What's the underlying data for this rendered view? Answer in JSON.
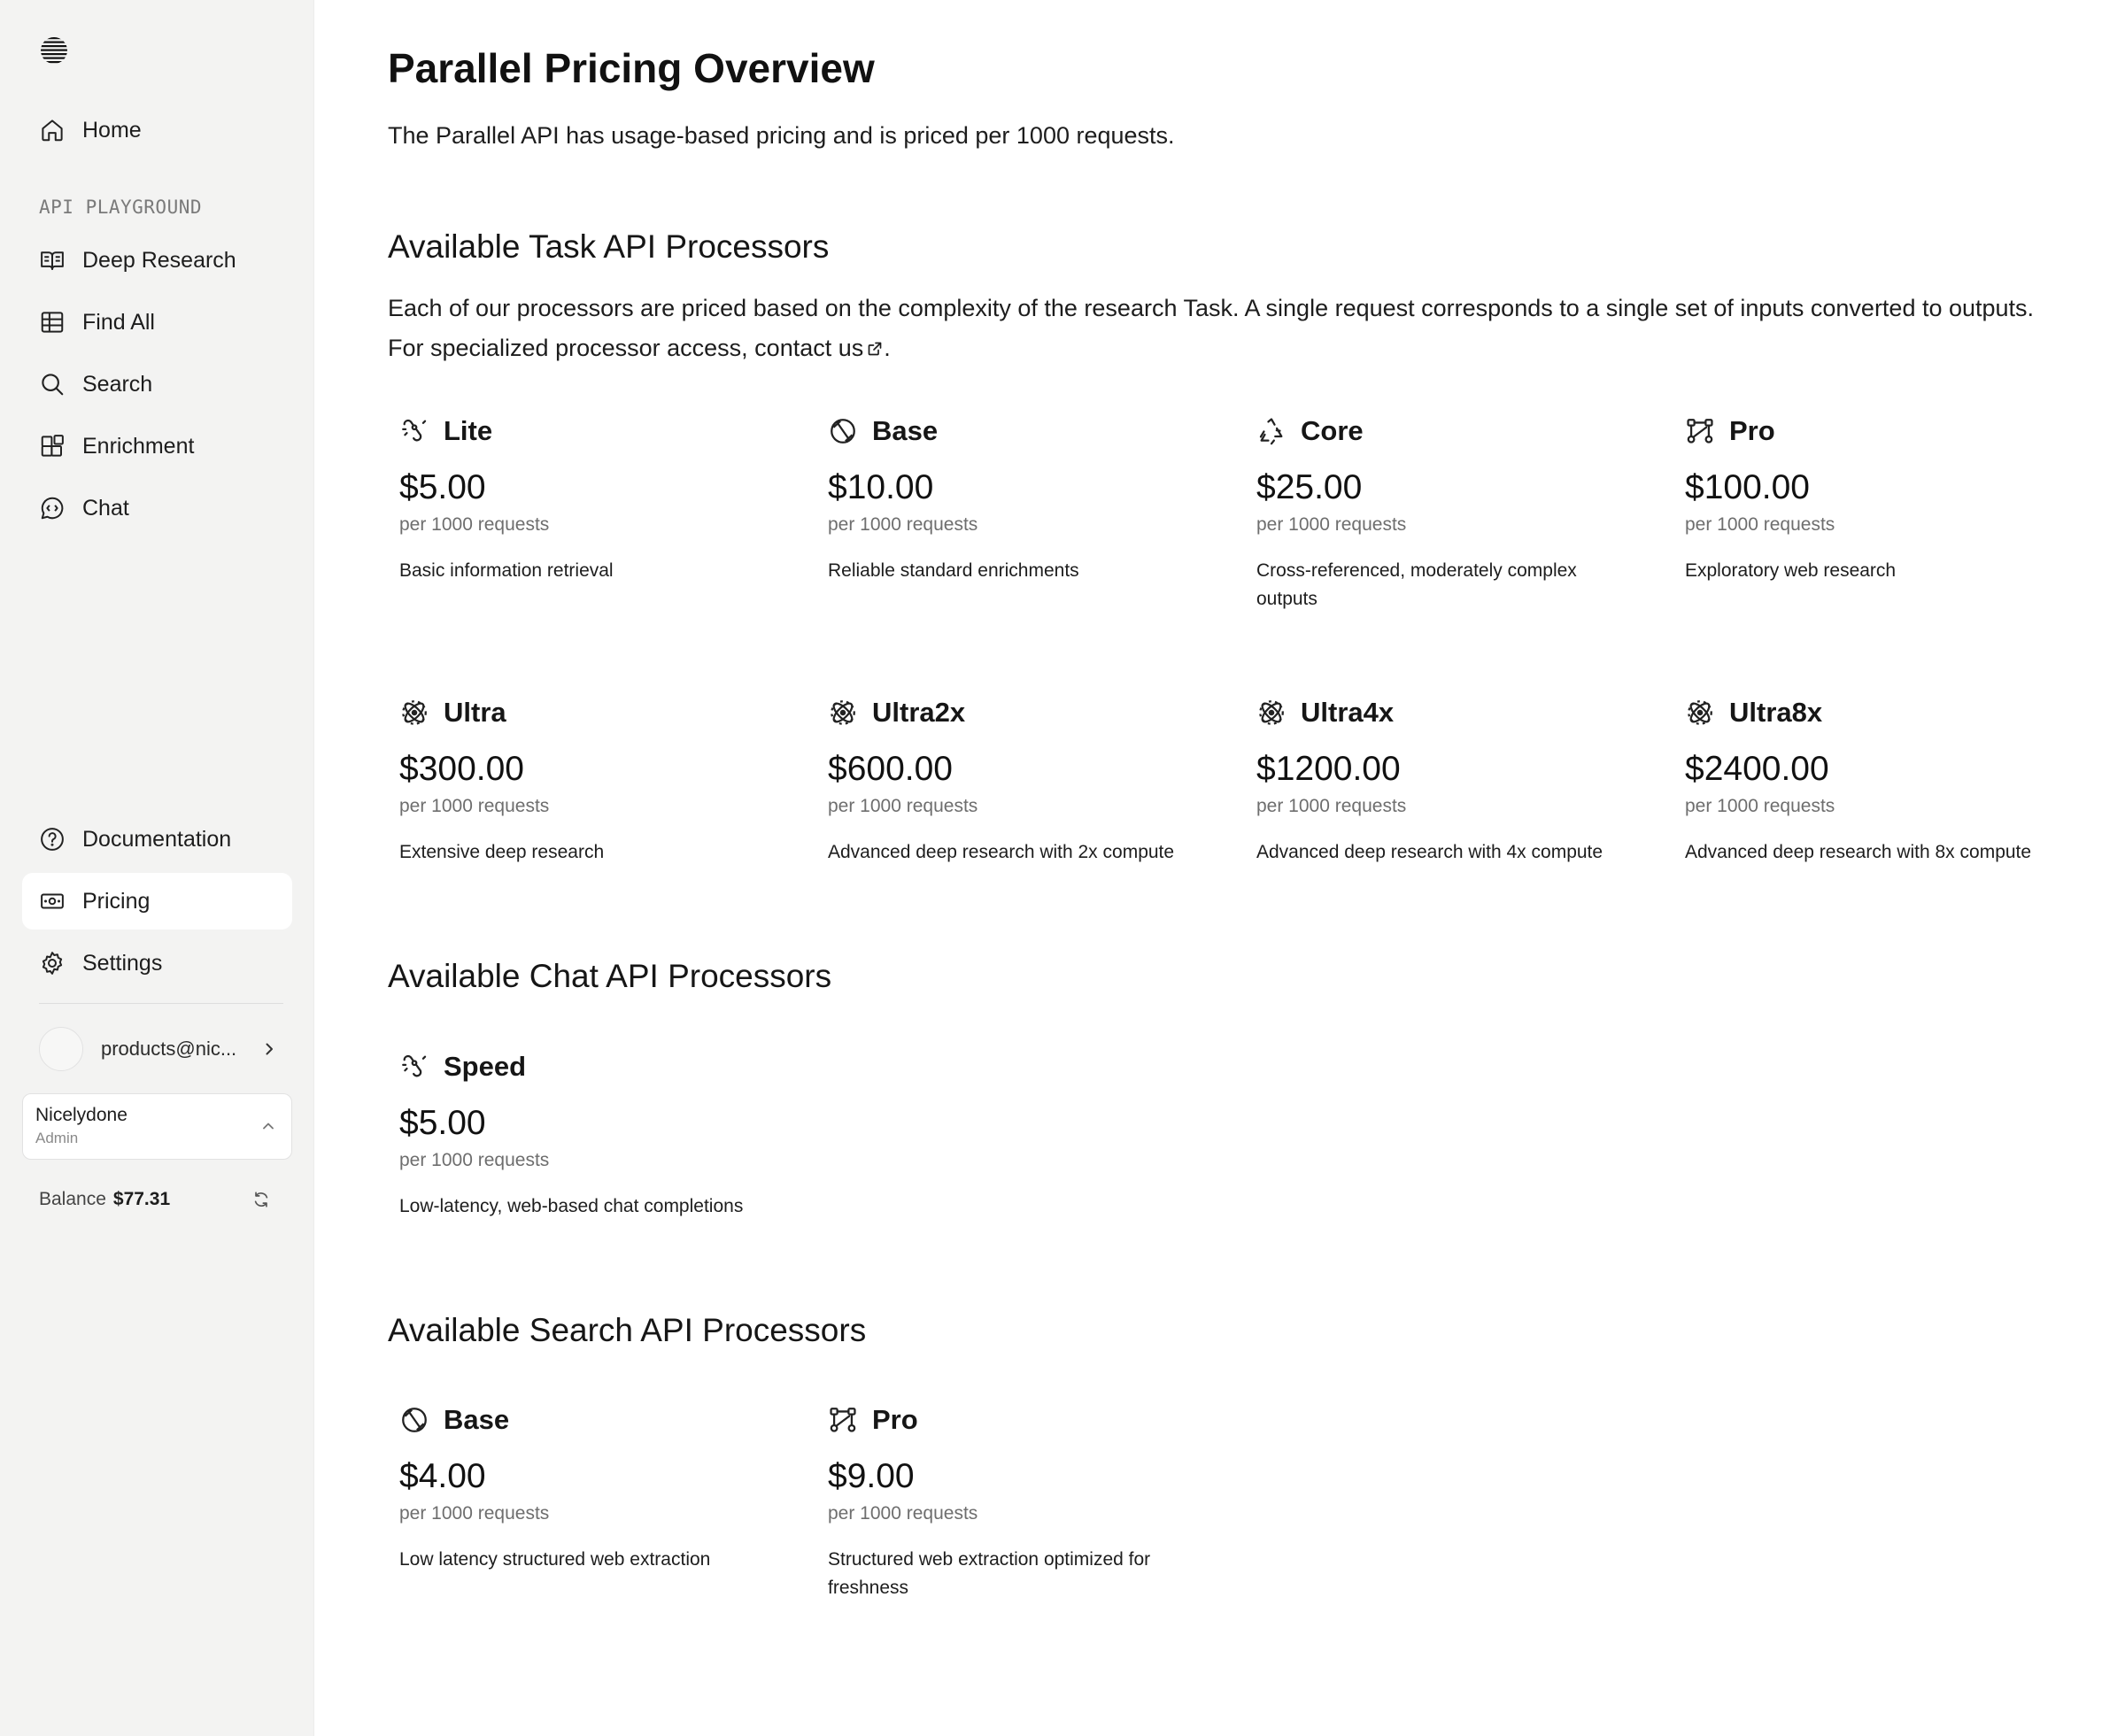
{
  "sidebar": {
    "top_items": [
      {
        "label": "Home",
        "icon": "home-icon"
      }
    ],
    "section_label": "API PLAYGROUND",
    "playground_items": [
      {
        "label": "Deep Research",
        "icon": "book-open-icon"
      },
      {
        "label": "Find All",
        "icon": "grid-icon"
      },
      {
        "label": "Search",
        "icon": "search-icon"
      },
      {
        "label": "Enrichment",
        "icon": "blocks-icon"
      },
      {
        "label": "Chat",
        "icon": "chat-icon"
      }
    ],
    "bottom_items": [
      {
        "label": "Documentation",
        "icon": "help-circle-icon"
      },
      {
        "label": "Pricing",
        "icon": "banknote-icon",
        "active": true
      },
      {
        "label": "Settings",
        "icon": "gear-icon"
      }
    ],
    "user_email": "products@nic...",
    "org_name": "Nicelydone",
    "org_role": "Admin",
    "balance_label": "Balance",
    "balance_amount": "$77.31"
  },
  "page": {
    "title": "Parallel Pricing Overview",
    "subtitle": "The Parallel API has usage-based pricing and is priced per 1000 requests."
  },
  "task_section": {
    "title": "Available Task API Processors",
    "description": "Each of our processors are priced based on the complexity of the research Task. A single request corresponds to a single set of inputs converted to outputs.",
    "contact_prefix": "For specialized processor access, ",
    "contact_link": "contact us",
    "contact_suffix": ".",
    "processors": [
      {
        "name": "Lite",
        "price": "$5.00",
        "unit": "per 1000 requests",
        "desc": "Basic information retrieval",
        "icon": "link-loop-icon"
      },
      {
        "name": "Base",
        "price": "$10.00",
        "unit": "per 1000 requests",
        "desc": "Reliable standard enrichments",
        "icon": "slash-circle-icon"
      },
      {
        "name": "Core",
        "price": "$25.00",
        "unit": "per 1000 requests",
        "desc": "Cross-referenced, moderately complex outputs",
        "icon": "recycle-icon"
      },
      {
        "name": "Pro",
        "price": "$100.00",
        "unit": "per 1000 requests",
        "desc": "Exploratory web research",
        "icon": "route-icon"
      },
      {
        "name": "Ultra",
        "price": "$300.00",
        "unit": "per 1000 requests",
        "desc": "Extensive deep research",
        "icon": "atom-icon"
      },
      {
        "name": "Ultra2x",
        "price": "$600.00",
        "unit": "per 1000 requests",
        "desc": "Advanced deep research with 2x compute",
        "icon": "atom-icon"
      },
      {
        "name": "Ultra4x",
        "price": "$1200.00",
        "unit": "per 1000 requests",
        "desc": "Advanced deep research with 4x compute",
        "icon": "atom-icon"
      },
      {
        "name": "Ultra8x",
        "price": "$2400.00",
        "unit": "per 1000 requests",
        "desc": "Advanced deep research with 8x compute",
        "icon": "atom-icon"
      }
    ]
  },
  "chat_section": {
    "title": "Available Chat API Processors",
    "processors": [
      {
        "name": "Speed",
        "price": "$5.00",
        "unit": "per 1000 requests",
        "desc": "Low-latency, web-based chat completions",
        "icon": "link-loop-icon"
      }
    ]
  },
  "search_section": {
    "title": "Available Search API Processors",
    "processors": [
      {
        "name": "Base",
        "price": "$4.00",
        "unit": "per 1000 requests",
        "desc": "Low latency structured web extraction",
        "icon": "slash-circle-icon"
      },
      {
        "name": "Pro",
        "price": "$9.00",
        "unit": "per 1000 requests",
        "desc": "Structured web extraction optimized for freshness",
        "icon": "route-icon"
      }
    ]
  }
}
